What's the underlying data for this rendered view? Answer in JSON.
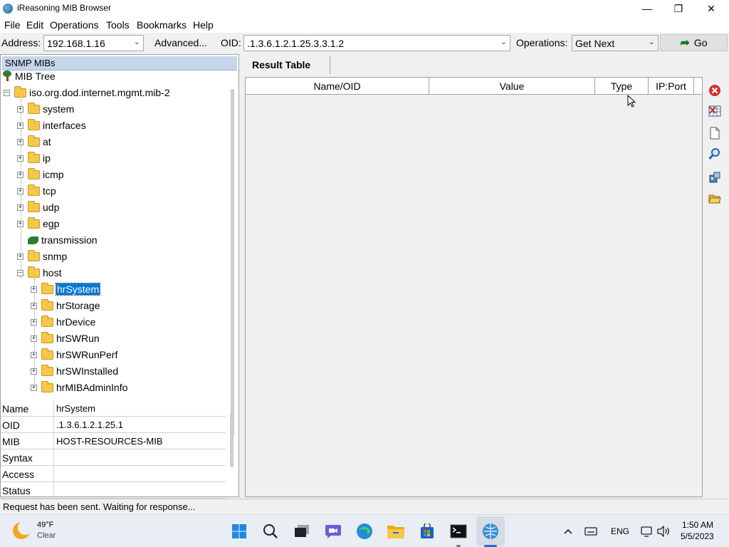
{
  "window": {
    "title": "iReasoning MIB Browser",
    "controls": {
      "minimize": "—",
      "maximize": "❐",
      "close": "✕"
    }
  },
  "menu": [
    "File",
    "Edit",
    "Operations",
    "Tools",
    "Bookmarks",
    "Help"
  ],
  "toolbar": {
    "address_label": "Address:",
    "address_value": "192.168.1.16",
    "advanced_label": "Advanced...",
    "oid_label": "OID:",
    "oid_value": ".1.3.6.1.2.1.25.3.3.1.2",
    "operations_label": "Operations:",
    "operations_value": "Get Next",
    "go_label": "Go"
  },
  "left_panel": {
    "header": "SNMP MIBs",
    "tree": {
      "root": "MIB Tree",
      "branch": "iso.org.dod.internet.mgmt.mib-2",
      "children": [
        "system",
        "interfaces",
        "at",
        "ip",
        "icmp",
        "tcp",
        "udp",
        "egp",
        "transmission",
        "snmp",
        "host"
      ],
      "host_children": [
        "hrSystem",
        "hrStorage",
        "hrDevice",
        "hrSWRun",
        "hrSWRunPerf",
        "hrSWInstalled",
        "hrMIBAdminInfo"
      ],
      "selected": "hrSystem"
    },
    "properties": [
      {
        "key": "Name",
        "value": "hrSystem"
      },
      {
        "key": "OID",
        "value": ".1.3.6.1.2.1.25.1"
      },
      {
        "key": "MIB",
        "value": "HOST-RESOURCES-MIB"
      },
      {
        "key": "Syntax",
        "value": ""
      },
      {
        "key": "Access",
        "value": ""
      },
      {
        "key": "Status",
        "value": ""
      }
    ]
  },
  "result": {
    "tab": "Result Table",
    "columns": [
      "Name/OID",
      "Value",
      "Type",
      "IP:Port"
    ]
  },
  "side_tools": [
    "delete-icon",
    "table-delete-icon",
    "document-icon",
    "find-icon",
    "export-icon",
    "open-folder-icon"
  ],
  "status": "Request has been sent. Waiting for response...",
  "taskbar": {
    "weather_temp": "49°F",
    "weather_desc": "Clear",
    "lang": "ENG",
    "time": "1:50 AM",
    "date": "5/5/2023",
    "apps": [
      "start-icon",
      "search-icon",
      "task-view-icon",
      "chat-icon",
      "edge-icon",
      "file-explorer-icon",
      "store-icon",
      "terminal-icon",
      "mib-browser-icon"
    ]
  }
}
